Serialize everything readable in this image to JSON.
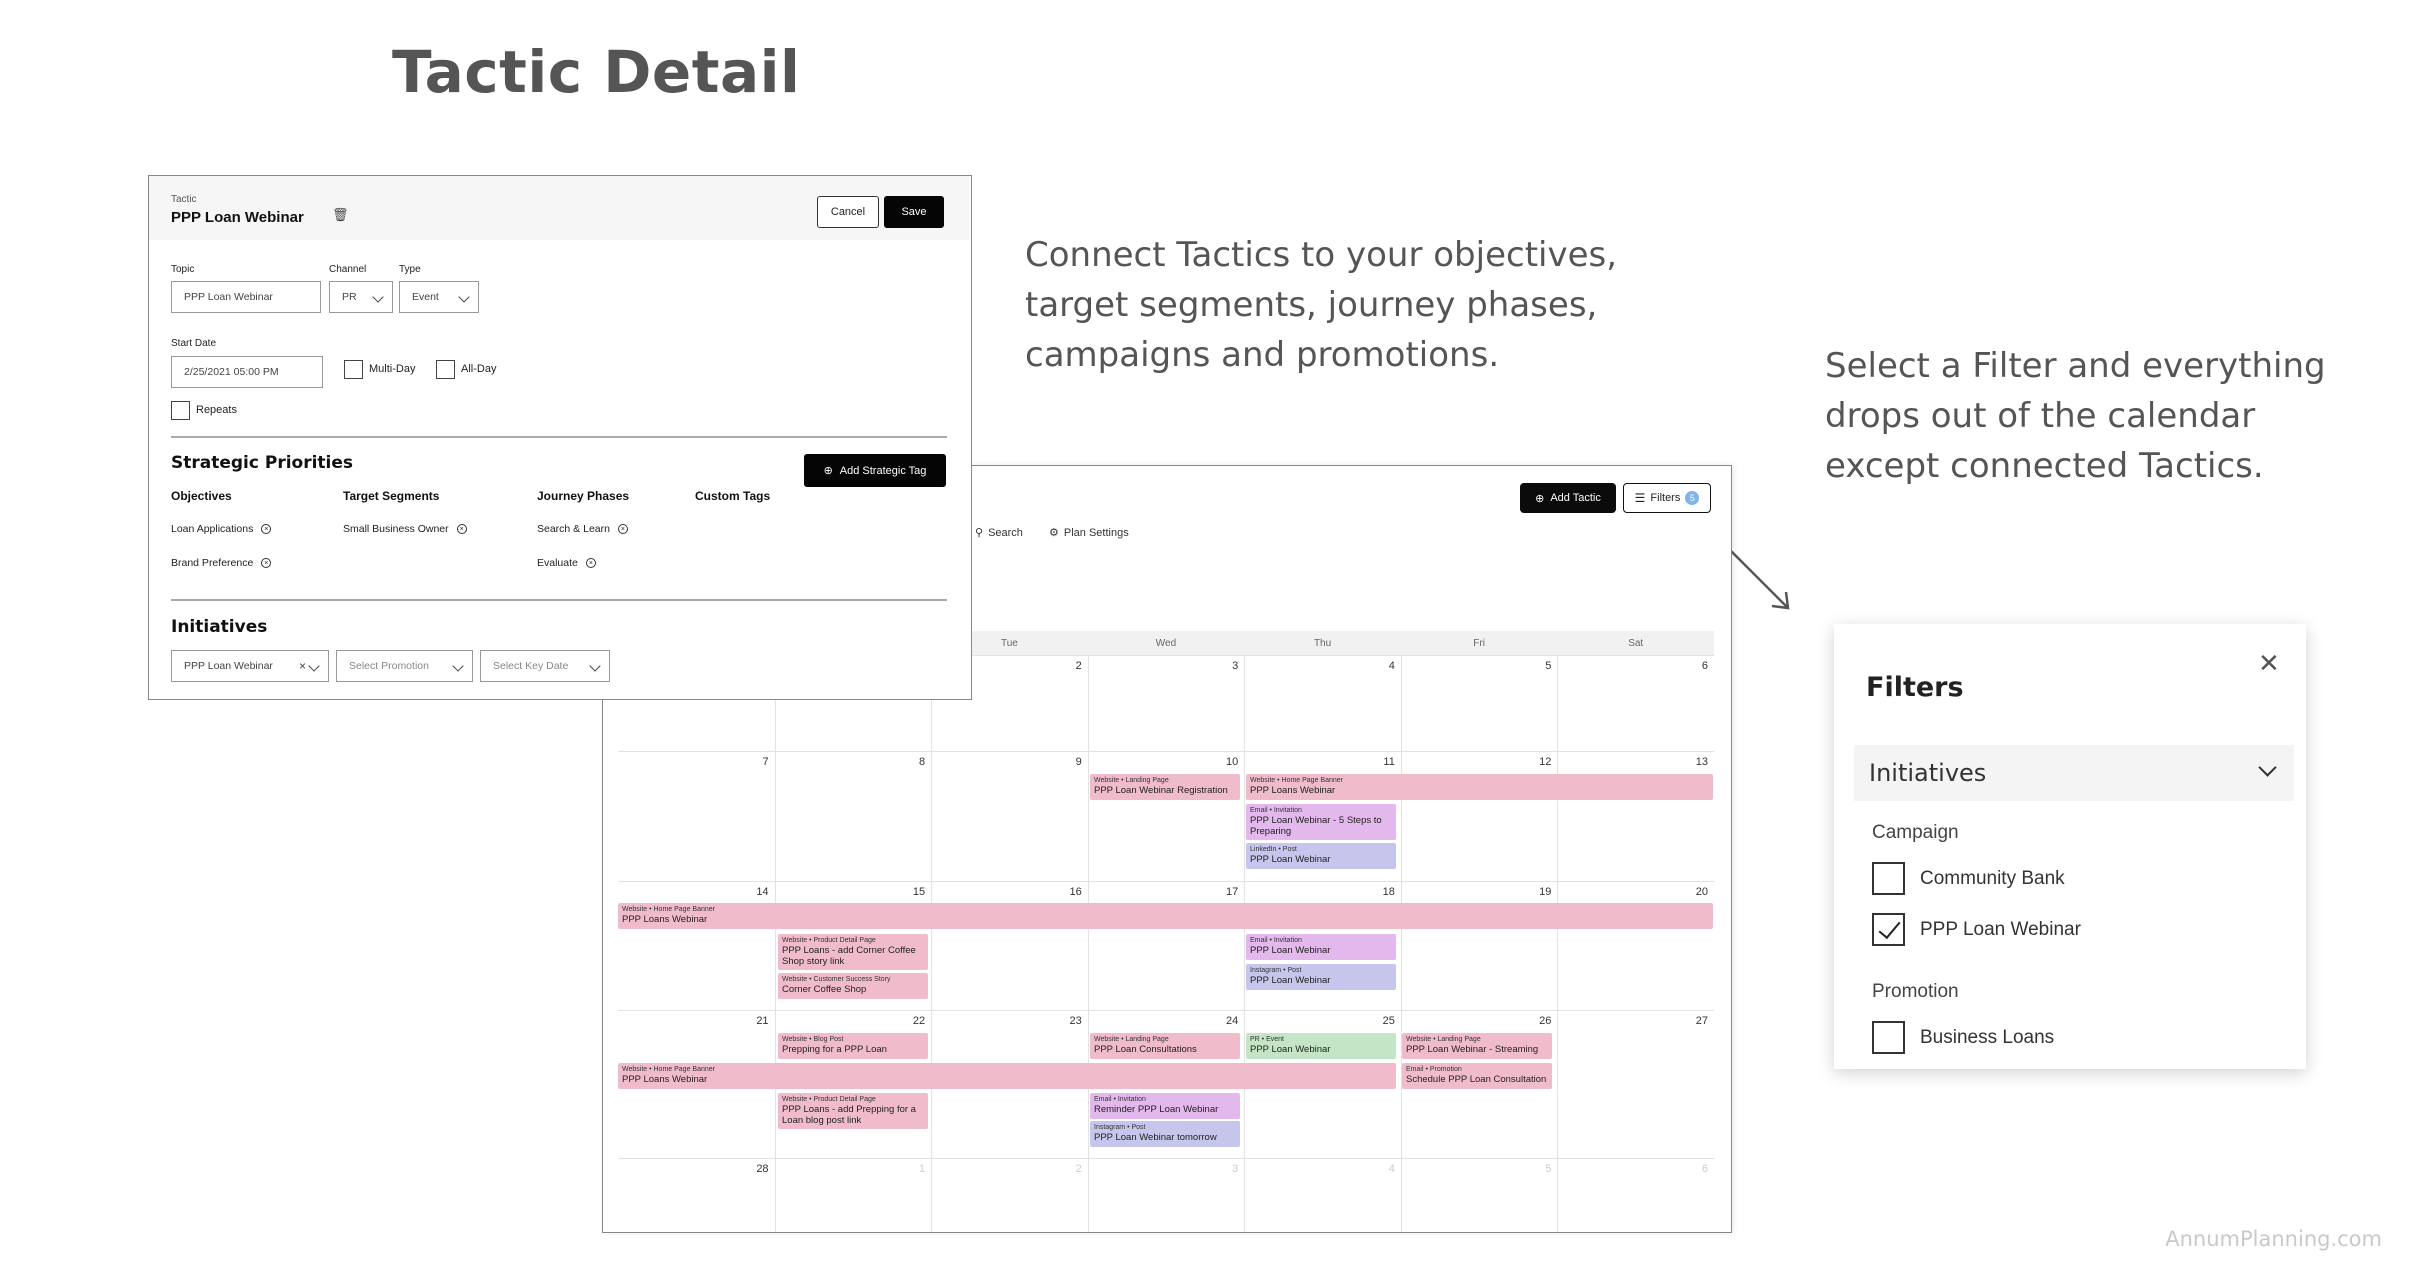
{
  "page": {
    "title": "Tactic Detail",
    "caption_left": [
      "Connect Tactics to your objectives,",
      "target segments, journey phases,",
      "campaigns and promotions."
    ],
    "caption_right": [
      "Select a Filter and everything",
      "drops out of the calendar",
      "except connected Tactics."
    ],
    "footer": "AnnumPlanning.com"
  },
  "tactic": {
    "eyebrow": "Tactic",
    "name": "PPP Loan Webinar",
    "cancel_label": "Cancel",
    "save_label": "Save",
    "topic_label": "Topic",
    "topic_value": "PPP Loan Webinar",
    "channel_label": "Channel",
    "channel_value": "PR",
    "type_label": "Type",
    "type_value": "Event",
    "start_label": "Start Date",
    "start_value": "2/25/2021 05:00 PM",
    "multiday_label": "Multi-Day",
    "allday_label": "All-Day",
    "repeats_label": "Repeats",
    "strategic_title": "Strategic Priorities",
    "add_tag_label": "Add Strategic Tag",
    "columns": {
      "objectives": "Objectives",
      "segments": "Target Segments",
      "phases": "Journey Phases",
      "custom": "Custom Tags"
    },
    "objectives": [
      "Loan Applications",
      "Brand Preference"
    ],
    "segments": [
      "Small Business Owner"
    ],
    "phases": [
      "Search & Learn",
      "Evaluate"
    ],
    "initiatives_title": "Initiatives",
    "initiative_value": "PPP Loan Webinar",
    "promotion_placeholder": "Select Promotion",
    "keydate_placeholder": "Select Key Date"
  },
  "calendar": {
    "add_tactic_label": "Add Tactic",
    "filters_label": "Filters",
    "filters_count": "5",
    "search_label": "Search",
    "plan_settings_label": "Plan Settings",
    "dow": [
      "",
      "",
      "Tue",
      "Wed",
      "Thu",
      "Fri",
      "Sat"
    ],
    "weeks": [
      [
        "",
        "",
        "2",
        "3",
        "4",
        "5",
        "6"
      ],
      [
        "7",
        "8",
        "9",
        "10",
        "11",
        "12",
        "13"
      ],
      [
        "14",
        "15",
        "16",
        "17",
        "18",
        "19",
        "20"
      ],
      [
        "21",
        "22",
        "23",
        "24",
        "25",
        "26",
        "27"
      ],
      [
        "28",
        "1",
        "2",
        "3",
        "4",
        "5",
        "6"
      ]
    ],
    "events": [
      {
        "ch": "Website • Landing Page",
        "nm": "PPP Loan Webinar Registration"
      },
      {
        "ch": "Website • Home Page Banner",
        "nm": "PPP Loans Webinar"
      },
      {
        "ch": "Email • Invitation",
        "nm": "PPP Loan Webinar - 5 Steps to Preparing"
      },
      {
        "ch": "LinkedIn • Post",
        "nm": "PPP Loan Webinar"
      },
      {
        "ch": "Website • Home Page Banner",
        "nm": "PPP Loans Webinar"
      },
      {
        "ch": "Website • Product Detail Page",
        "nm": "PPP Loans - add Corner Coffee Shop story link"
      },
      {
        "ch": "Website • Customer Success Story",
        "nm": "Corner Coffee Shop"
      },
      {
        "ch": "Email • Invitation",
        "nm": "PPP Loan Webinar"
      },
      {
        "ch": "Instagram • Post",
        "nm": "PPP Loan Webinar"
      },
      {
        "ch": "Website • Blog Post",
        "nm": "Prepping for a PPP Loan"
      },
      {
        "ch": "Website • Landing Page",
        "nm": "PPP Loan Consultations"
      },
      {
        "ch": "PR • Event",
        "nm": "PPP Loan Webinar"
      },
      {
        "ch": "Website • Landing Page",
        "nm": "PPP Loan Webinar - Streaming"
      },
      {
        "ch": "Website • Home Page Banner",
        "nm": "PPP Loans Webinar"
      },
      {
        "ch": "Email • Promotion",
        "nm": "Schedule PPP Loan Consultation"
      },
      {
        "ch": "Website • Product Detail Page",
        "nm": "PPP Loans - add Prepping for a Loan blog post link"
      },
      {
        "ch": "Email • Invitation",
        "nm": "Reminder PPP Loan Webinar"
      },
      {
        "ch": "Instagram • Post",
        "nm": "PPP Loan Webinar tomorrow"
      }
    ],
    "colors": {
      "pink": "#f0bccb",
      "purple": "#e3b8ec",
      "lavender": "#c6c6ec",
      "green": "#c5e6c6"
    }
  },
  "filters": {
    "title": "Filters",
    "accordion_label": "Initiatives",
    "campaign_label": "Campaign",
    "campaign_options": [
      {
        "label": "Community Bank",
        "checked": false
      },
      {
        "label": "PPP Loan Webinar",
        "checked": true
      }
    ],
    "promotion_label": "Promotion",
    "promotion_options": [
      {
        "label": "Business Loans",
        "checked": false
      }
    ]
  }
}
